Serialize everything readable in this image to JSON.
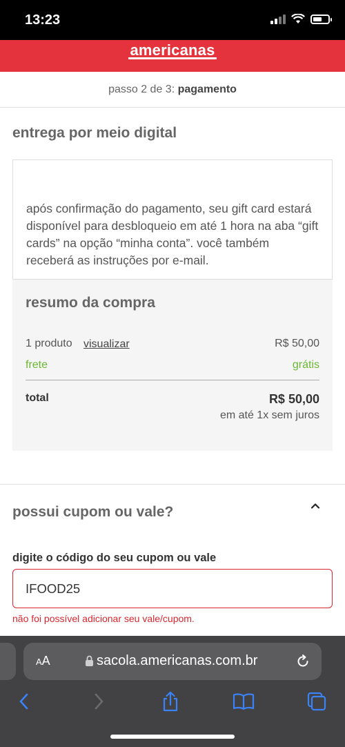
{
  "status": {
    "time": "13:23"
  },
  "brand": {
    "logo": "americanas"
  },
  "checkout": {
    "step_prefix": "passo 2 de 3:",
    "step_name": "pagamento"
  },
  "delivery": {
    "title": "entrega por meio digital",
    "message": "após confirmação do pagamento, seu gift card estará disponível para desbloqueio em até 1 hora na aba “gift cards” na opção “minha conta”. você também receberá as instruções por e-mail."
  },
  "summary": {
    "title": "resumo da compra",
    "products_label": "1 produto",
    "view_link": "visualizar",
    "products_value": "R$ 50,00",
    "shipping_label": "frete",
    "shipping_value": "grátis",
    "total_label": "total",
    "total_value": "R$ 50,00",
    "installments": "em até 1x sem juros"
  },
  "coupon": {
    "title": "possui cupom ou vale?",
    "field_label": "digite o código do seu cupom ou vale",
    "value": "IFOOD25",
    "error": "não foi possível adicionar seu vale/cupom."
  },
  "browser": {
    "aa_small": "A",
    "aa_large": "A",
    "url": "sacola.americanas.com.br"
  },
  "colors": {
    "brand_red": "#e4333c",
    "success_green": "#6bb632",
    "error_red": "#d9262e",
    "safari_blue": "#3b82f6"
  }
}
